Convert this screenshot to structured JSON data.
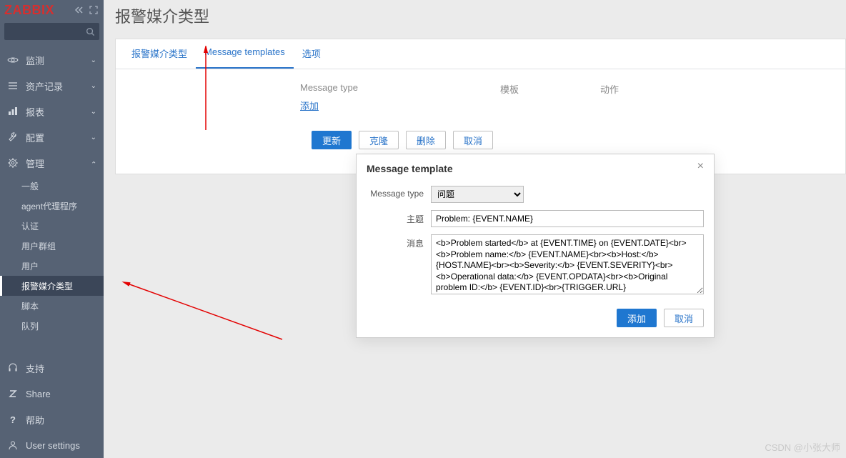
{
  "logo": "ZABBIX",
  "page_title": "报警媒介类型",
  "sidebar": {
    "nav": [
      {
        "label": "监测"
      },
      {
        "label": "资产记录"
      },
      {
        "label": "报表"
      },
      {
        "label": "配置"
      },
      {
        "label": "管理"
      }
    ],
    "admin_sub": [
      {
        "label": "一般"
      },
      {
        "label": "agent代理程序"
      },
      {
        "label": "认证"
      },
      {
        "label": "用户群组"
      },
      {
        "label": "用户"
      },
      {
        "label": "报警媒介类型"
      },
      {
        "label": "脚本"
      },
      {
        "label": "队列"
      }
    ],
    "bottom": [
      {
        "label": "支持"
      },
      {
        "label": "Share"
      },
      {
        "label": "帮助"
      },
      {
        "label": "User settings"
      }
    ]
  },
  "tabs": [
    {
      "label": "报警媒介类型"
    },
    {
      "label": "Message templates"
    },
    {
      "label": "选项"
    }
  ],
  "table": {
    "col_msgtype": "Message type",
    "col_template": "模板",
    "col_action": "动作",
    "add_link": "添加"
  },
  "buttons": {
    "update": "更新",
    "clone": "克隆",
    "delete": "删除",
    "cancel": "取消"
  },
  "modal": {
    "title": "Message template",
    "label_msgtype": "Message type",
    "msgtype_value": "问题",
    "label_subject": "主题",
    "subject_value": "Problem: {EVENT.NAME}",
    "label_message": "消息",
    "message_value": "<b>Problem started</b> at {EVENT.TIME} on {EVENT.DATE}<br><b>Problem name:</b> {EVENT.NAME}<br><b>Host:</b> {HOST.NAME}<br><b>Severity:</b> {EVENT.SEVERITY}<br><b>Operational data:</b> {EVENT.OPDATA}<br><b>Original problem ID:</b> {EVENT.ID}<br>{TRIGGER.URL}",
    "btn_add": "添加",
    "btn_cancel": "取消"
  },
  "watermark": "CSDN @小张大师"
}
